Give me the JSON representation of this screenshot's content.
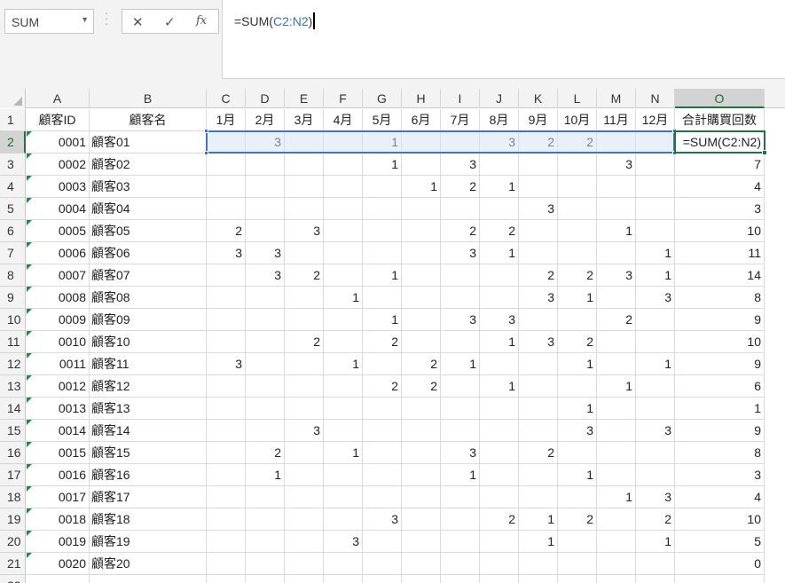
{
  "name_box": {
    "value": "SUM"
  },
  "formula_buttons": {
    "cancel": "✕",
    "enter": "✓",
    "fx": "fx"
  },
  "formula_bar": {
    "prefix": "=SUM(",
    "range_ref": "C2:N2",
    "suffix": ")"
  },
  "columns": [
    "A",
    "B",
    "C",
    "D",
    "E",
    "F",
    "G",
    "H",
    "I",
    "J",
    "K",
    "L",
    "M",
    "N",
    "O"
  ],
  "header_row": [
    "顧客ID",
    "顧客名",
    "1月",
    "2月",
    "3月",
    "4月",
    "5月",
    "6月",
    "7月",
    "8月",
    "9月",
    "10月",
    "11月",
    "12月",
    "合計購買回数"
  ],
  "rows": [
    [
      "0001",
      "顧客01",
      "",
      "3",
      "",
      "",
      "1",
      "",
      "",
      "3",
      "2",
      "2",
      "",
      "",
      "=SUM(C2:N2)"
    ],
    [
      "0002",
      "顧客02",
      "",
      "",
      "",
      "",
      "1",
      "",
      "3",
      "",
      "",
      "",
      "3",
      "",
      "7"
    ],
    [
      "0003",
      "顧客03",
      "",
      "",
      "",
      "",
      "",
      "1",
      "2",
      "1",
      "",
      "",
      "",
      "",
      "4"
    ],
    [
      "0004",
      "顧客04",
      "",
      "",
      "",
      "",
      "",
      "",
      "",
      "",
      "3",
      "",
      "",
      "",
      "3"
    ],
    [
      "0005",
      "顧客05",
      "2",
      "",
      "3",
      "",
      "",
      "",
      "2",
      "2",
      "",
      "",
      "1",
      "",
      "10"
    ],
    [
      "0006",
      "顧客06",
      "3",
      "3",
      "",
      "",
      "",
      "",
      "3",
      "1",
      "",
      "",
      "",
      "1",
      "11"
    ],
    [
      "0007",
      "顧客07",
      "",
      "3",
      "2",
      "",
      "1",
      "",
      "",
      "",
      "2",
      "2",
      "3",
      "1",
      "14"
    ],
    [
      "0008",
      "顧客08",
      "",
      "",
      "",
      "1",
      "",
      "",
      "",
      "",
      "3",
      "1",
      "",
      "3",
      "8"
    ],
    [
      "0009",
      "顧客09",
      "",
      "",
      "",
      "",
      "1",
      "",
      "3",
      "3",
      "",
      "",
      "2",
      "",
      "9"
    ],
    [
      "0010",
      "顧客10",
      "",
      "",
      "2",
      "",
      "2",
      "",
      "",
      "1",
      "3",
      "2",
      "",
      "",
      "10"
    ],
    [
      "0011",
      "顧客11",
      "3",
      "",
      "",
      "1",
      "",
      "2",
      "1",
      "",
      "",
      "1",
      "",
      "1",
      "9"
    ],
    [
      "0012",
      "顧客12",
      "",
      "",
      "",
      "",
      "2",
      "2",
      "",
      "1",
      "",
      "",
      "1",
      "",
      "6"
    ],
    [
      "0013",
      "顧客13",
      "",
      "",
      "",
      "",
      "",
      "",
      "",
      "",
      "",
      "1",
      "",
      "",
      "1"
    ],
    [
      "0014",
      "顧客14",
      "",
      "",
      "3",
      "",
      "",
      "",
      "",
      "",
      "",
      "3",
      "",
      "3",
      "9"
    ],
    [
      "0015",
      "顧客15",
      "",
      "2",
      "",
      "1",
      "",
      "",
      "3",
      "",
      "2",
      "",
      "",
      "",
      "8"
    ],
    [
      "0016",
      "顧客16",
      "",
      "1",
      "",
      "",
      "",
      "",
      "1",
      "",
      "",
      "1",
      "",
      "",
      "3"
    ],
    [
      "0017",
      "顧客17",
      "",
      "",
      "",
      "",
      "",
      "",
      "",
      "",
      "",
      "",
      "1",
      "3",
      "4"
    ],
    [
      "0018",
      "顧客18",
      "",
      "",
      "",
      "",
      "3",
      "",
      "",
      "2",
      "1",
      "2",
      "",
      "2",
      "10"
    ],
    [
      "0019",
      "顧客19",
      "",
      "",
      "",
      "3",
      "",
      "",
      "",
      "",
      "1",
      "",
      "",
      "1",
      "5"
    ],
    [
      "0020",
      "顧客20",
      "",
      "",
      "",
      "",
      "",
      "",
      "",
      "",
      "",
      "",
      "",
      "",
      "0"
    ]
  ],
  "active_cell": "O2",
  "selected_range": "C2:N2"
}
